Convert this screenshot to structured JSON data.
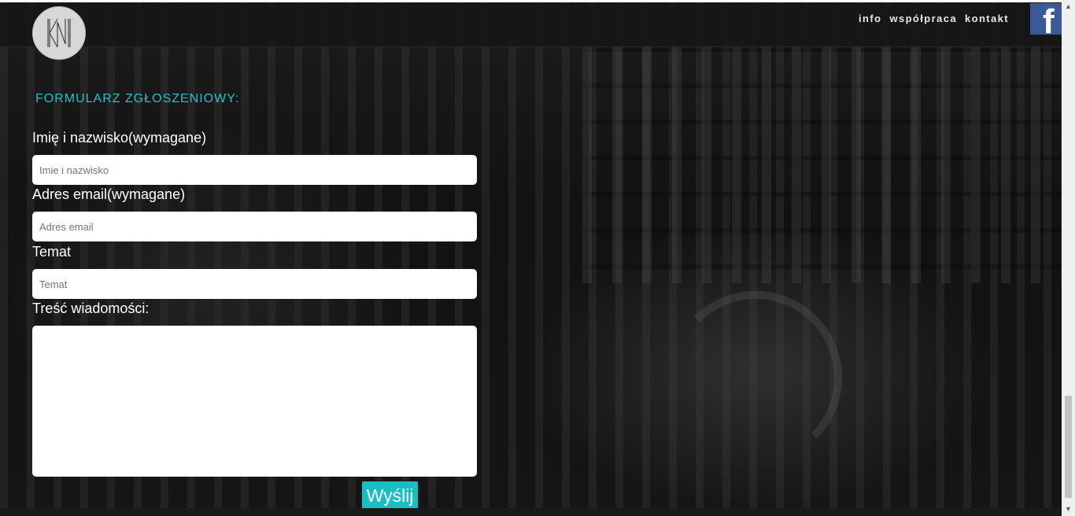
{
  "header": {
    "nav": [
      "info",
      "współpraca",
      "kontakt"
    ],
    "facebook_letter": "f",
    "logo_icon": "knu-monogram-logo"
  },
  "form": {
    "title": "FORMULARZ ZGŁOSZENIOWY:",
    "name_label": "Imię i nazwisko(wymagane)",
    "name_placeholder": "Imie i nazwisko",
    "name_value": "",
    "email_label": "Adres email(wymagane)",
    "email_placeholder": "Adres email",
    "email_value": "",
    "subject_label": "Temat",
    "subject_placeholder": "Temat",
    "subject_value": "",
    "message_label": "Treść wiadomości:",
    "message_value": "",
    "submit_label": "Wyślij"
  },
  "colors": {
    "accent": "#17bfc4",
    "title": "#27c1c9",
    "facebook": "#3b5998"
  }
}
